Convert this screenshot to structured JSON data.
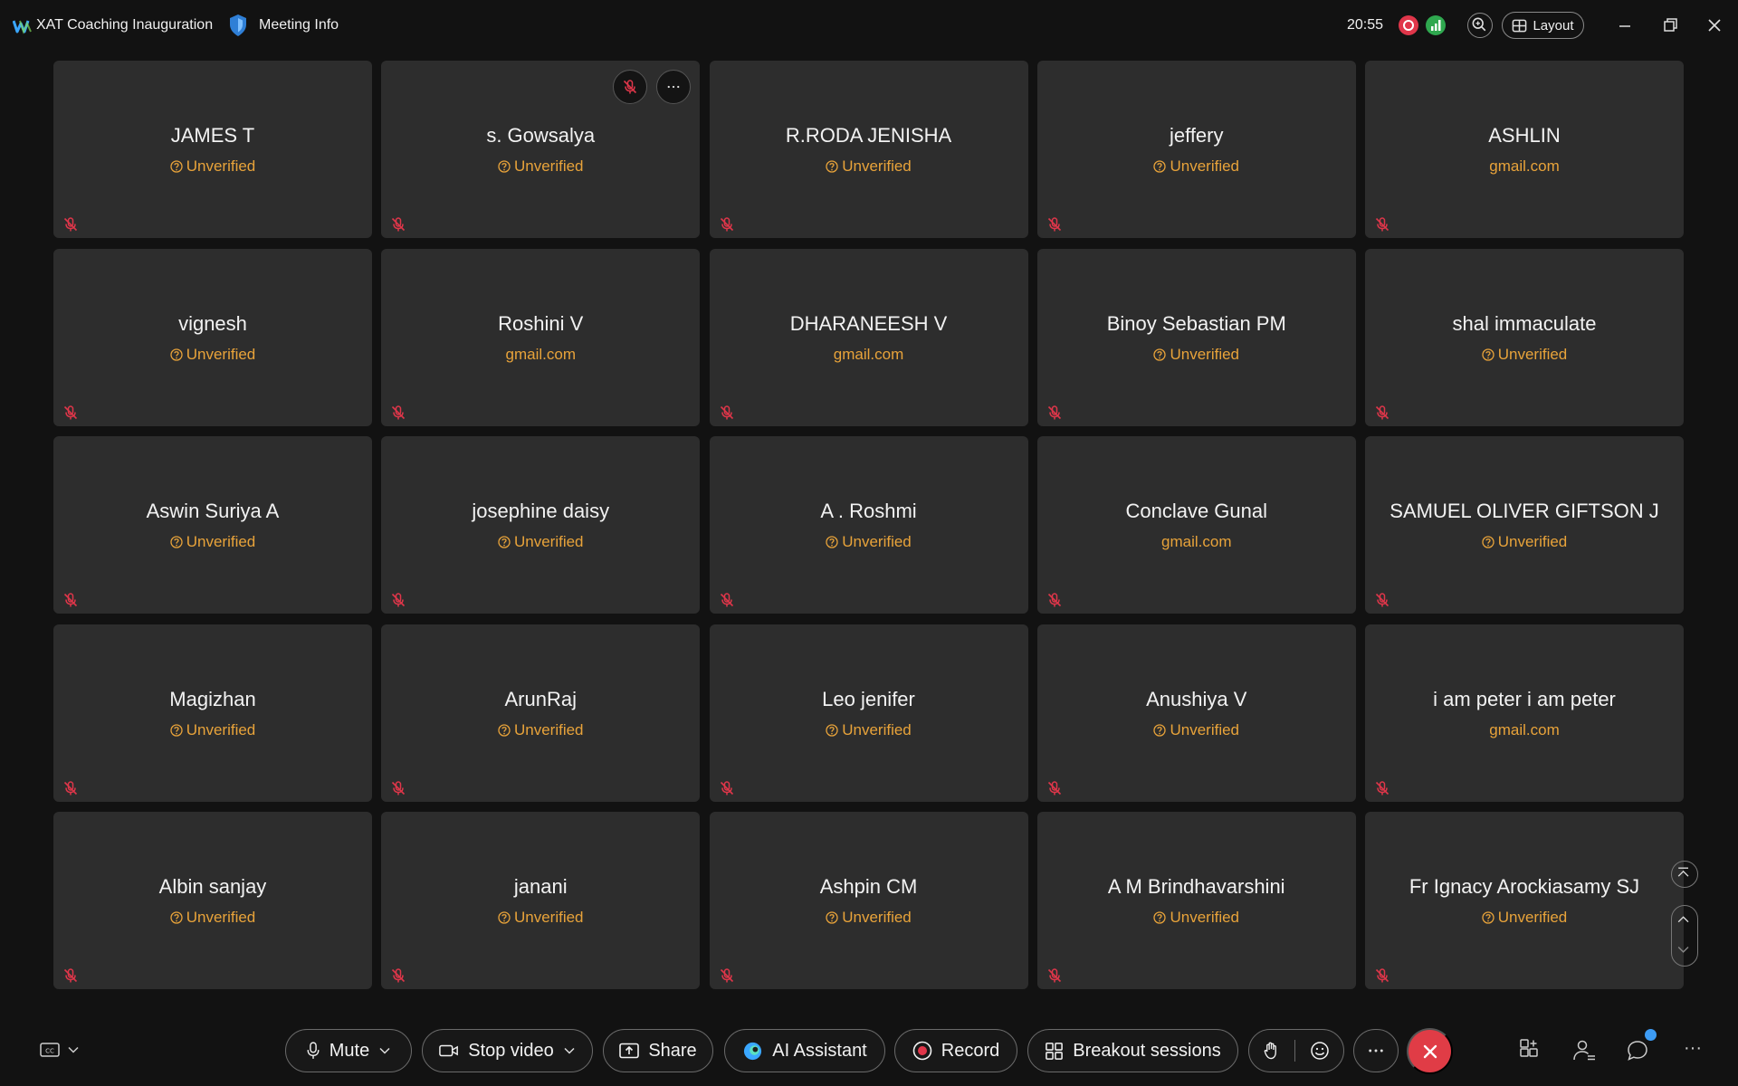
{
  "titlebar": {
    "app_title": "XAT Coaching Inauguration",
    "meeting_info": "Meeting Info",
    "time": "20:55",
    "layout_label": "Layout"
  },
  "participants": [
    {
      "name": "JAMES T",
      "status": "Unverified"
    },
    {
      "name": "s. Gowsalya",
      "status": "Unverified"
    },
    {
      "name": "R.RODA JENISHA",
      "status": "Unverified"
    },
    {
      "name": "jeffery",
      "status": "Unverified"
    },
    {
      "name": "ASHLIN",
      "status": "gmail.com"
    },
    {
      "name": "vignesh",
      "status": "Unverified"
    },
    {
      "name": "Roshini V",
      "status": "gmail.com"
    },
    {
      "name": "DHARANEESH V",
      "status": "gmail.com"
    },
    {
      "name": "Binoy Sebastian PM",
      "status": "Unverified"
    },
    {
      "name": "shal immaculate",
      "status": "Unverified"
    },
    {
      "name": "Aswin Suriya A",
      "status": "Unverified"
    },
    {
      "name": "josephine daisy",
      "status": "Unverified"
    },
    {
      "name": "A . Roshmi",
      "status": "Unverified"
    },
    {
      "name": "Conclave Gunal",
      "status": "gmail.com"
    },
    {
      "name": "SAMUEL OLIVER GIFTSON J",
      "status": "Unverified"
    },
    {
      "name": "Magizhan",
      "status": "Unverified"
    },
    {
      "name": "ArunRaj",
      "status": "Unverified"
    },
    {
      "name": "Leo jenifer",
      "status": "Unverified"
    },
    {
      "name": "Anushiya V",
      "status": "Unverified"
    },
    {
      "name": "i am peter i am peter",
      "status": "gmail.com"
    },
    {
      "name": "Albin sanjay",
      "status": "Unverified"
    },
    {
      "name": "janani",
      "status": "Unverified"
    },
    {
      "name": "Ashpin CM",
      "status": "Unverified"
    },
    {
      "name": "A M Brindhavarshini",
      "status": "Unverified"
    },
    {
      "name": "Fr Ignacy Arockiasamy SJ",
      "status": "Unverified"
    }
  ],
  "toolbar": {
    "mute": "Mute",
    "stop_video": "Stop video",
    "share": "Share",
    "ai_assistant": "AI Assistant",
    "record": "Record",
    "breakout": "Breakout sessions"
  },
  "colors": {
    "status_orange": "#e8a33a",
    "leave_red": "#e03c46",
    "record_red": "#e0364a",
    "signal_green": "#2fa84f",
    "chat_badge_blue": "#3d9cf5"
  }
}
